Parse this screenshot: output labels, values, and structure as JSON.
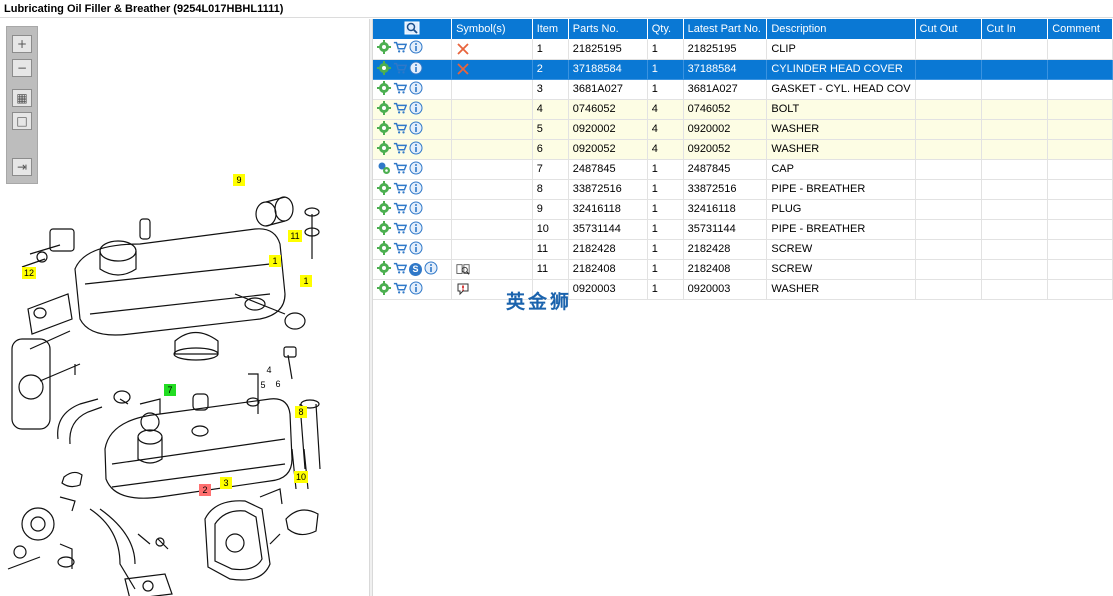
{
  "window": {
    "title": "Lubricating Oil Filler & Breather (9254L017HBHL1111)"
  },
  "toolbar": {
    "buttons": [
      {
        "name": "zoom-in-icon"
      },
      {
        "name": "zoom-out-icon"
      },
      {
        "name": "fit-all-icon"
      },
      {
        "name": "actual-size-icon"
      },
      {
        "name": "export-list-icon"
      }
    ]
  },
  "diagram": {
    "callouts": [
      "9",
      "11",
      "1",
      "1",
      "12",
      "7",
      "8",
      "2",
      "3",
      "10",
      "4",
      "5",
      "6"
    ]
  },
  "table": {
    "columns": [
      "",
      "Symbol(s)",
      "Item",
      "Parts No.",
      "Qty.",
      "Latest Part No.",
      "Description",
      "Cut Out",
      "Cut In",
      "Comment"
    ],
    "rows": [
      {
        "item": "1",
        "part_no": "21825195",
        "qty": "1",
        "latest": "21825195",
        "description": "CLIP",
        "symbol": "x",
        "style": "normal"
      },
      {
        "item": "2",
        "part_no": "37188584",
        "qty": "1",
        "latest": "37188584",
        "description": "CYLINDER HEAD COVER",
        "symbol": "x",
        "style": "selected"
      },
      {
        "item": "3",
        "part_no": "3681A027",
        "qty": "1",
        "latest": "3681A027",
        "description": "GASKET - CYL. HEAD COV",
        "symbol": "",
        "style": "normal"
      },
      {
        "item": "4",
        "part_no": "0746052",
        "qty": "4",
        "latest": "0746052",
        "description": "BOLT",
        "symbol": "",
        "style": "yellow"
      },
      {
        "item": "5",
        "part_no": "0920002",
        "qty": "4",
        "latest": "0920002",
        "description": "WASHER",
        "symbol": "",
        "style": "yellow"
      },
      {
        "item": "6",
        "part_no": "0920052",
        "qty": "4",
        "latest": "0920052",
        "description": "WASHER",
        "symbol": "",
        "style": "yellow"
      },
      {
        "item": "7",
        "part_no": "2487845",
        "qty": "1",
        "latest": "2487845",
        "description": "CAP",
        "symbol": "",
        "style": "normal"
      },
      {
        "item": "8",
        "part_no": "33872516",
        "qty": "1",
        "latest": "33872516",
        "description": "PIPE - BREATHER",
        "symbol": "",
        "style": "normal"
      },
      {
        "item": "9",
        "part_no": "32416118",
        "qty": "1",
        "latest": "32416118",
        "description": "PLUG",
        "symbol": "",
        "style": "normal"
      },
      {
        "item": "10",
        "part_no": "35731144",
        "qty": "1",
        "latest": "35731144",
        "description": "PIPE - BREATHER",
        "symbol": "",
        "style": "normal"
      },
      {
        "item": "11",
        "part_no": "2182428",
        "qty": "1",
        "latest": "2182428",
        "description": "SCREW",
        "symbol": "",
        "style": "normal"
      },
      {
        "item": "11",
        "part_no": "2182408",
        "qty": "1",
        "latest": "2182408",
        "description": "SCREW",
        "symbol": "book",
        "style": "normal"
      },
      {
        "item": "",
        "part_no": "0920003",
        "qty": "1",
        "latest": "0920003",
        "description": "WASHER",
        "symbol": "comment",
        "style": "normal"
      }
    ]
  },
  "overlay": {
    "watermark": "英金狮"
  },
  "colors": {
    "header_bg": "#0a78d4",
    "selected_row": "#0a78d4",
    "yellow_row": "#fdfde4",
    "callout_yellow": "#ffff00",
    "callout_green": "#22dd22",
    "callout_red": "#ff7070"
  }
}
